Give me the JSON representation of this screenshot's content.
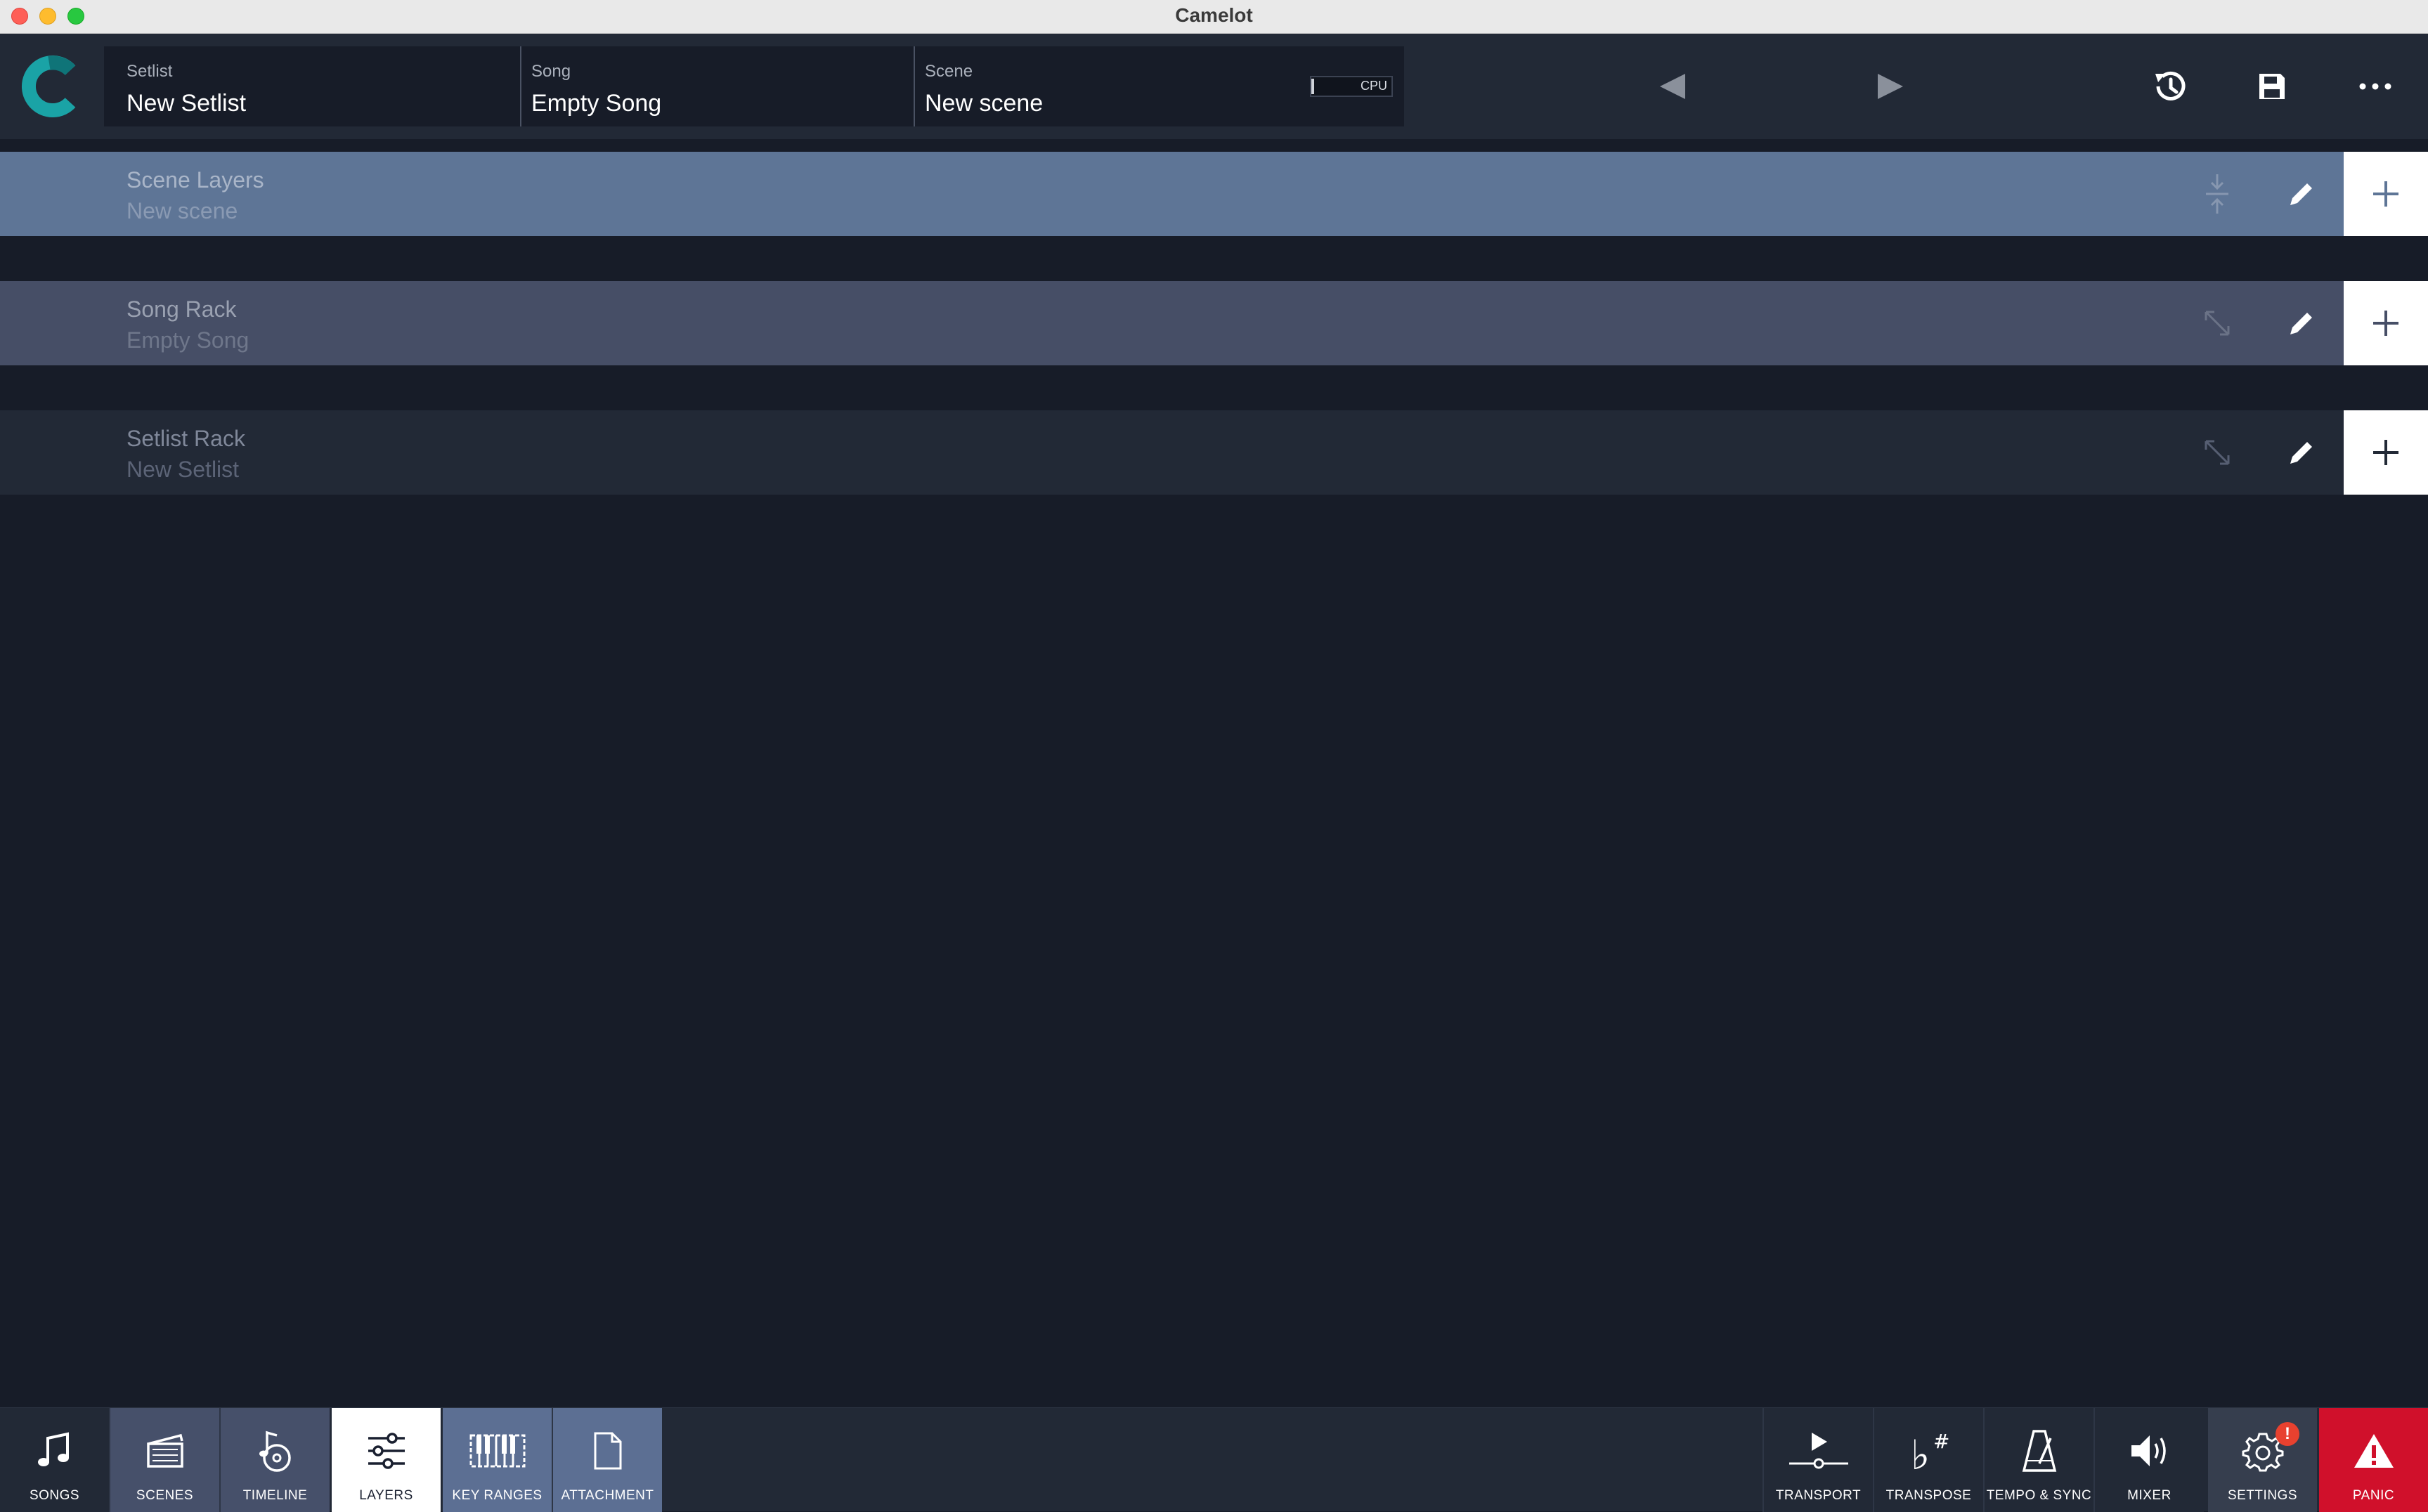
{
  "window": {
    "title": "Camelot"
  },
  "header": {
    "setlist": {
      "label": "Setlist",
      "value": "New Setlist"
    },
    "song": {
      "label": "Song",
      "value": "Empty Song"
    },
    "scene": {
      "label": "Scene",
      "value": "New scene"
    },
    "cpu_label": "CPU",
    "icons": [
      "chevron-left-icon",
      "chevron-right-icon",
      "history-icon",
      "save-icon",
      "more-icon"
    ]
  },
  "racks": [
    {
      "title": "Scene Layers",
      "subtitle": "New scene",
      "color": "#5e7596"
    },
    {
      "title": "Song Rack",
      "subtitle": "Empty Song",
      "color": "#464e66"
    },
    {
      "title": "Setlist Rack",
      "subtitle": "New Setlist",
      "color": "#222936"
    }
  ],
  "left_tabs": [
    {
      "label": "SONGS",
      "icon": "music-note-icon"
    },
    {
      "label": "SCENES",
      "icon": "clapperboard-icon"
    },
    {
      "label": "TIMELINE",
      "icon": "timeline-icon"
    },
    {
      "label": "LAYERS",
      "icon": "sliders-icon",
      "active": true
    },
    {
      "label": "KEY RANGES",
      "icon": "keyboard-icon"
    },
    {
      "label": "ATTACHMENT",
      "icon": "document-icon"
    }
  ],
  "right_tabs": [
    {
      "label": "TRANSPORT",
      "icon": "play-icon"
    },
    {
      "label": "TRANSPOSE",
      "icon": "flat-sharp-icon"
    },
    {
      "label": "TEMPO & SYNC",
      "icon": "metronome-icon"
    },
    {
      "label": "MIXER",
      "icon": "speaker-icon"
    },
    {
      "label": "SETTINGS",
      "icon": "gear-icon",
      "badge": "!"
    },
    {
      "label": "PANIC",
      "icon": "warning-icon"
    }
  ],
  "colors": {
    "accent": "#1aa3a6",
    "panic": "#d0102b",
    "background": "#171c28"
  }
}
